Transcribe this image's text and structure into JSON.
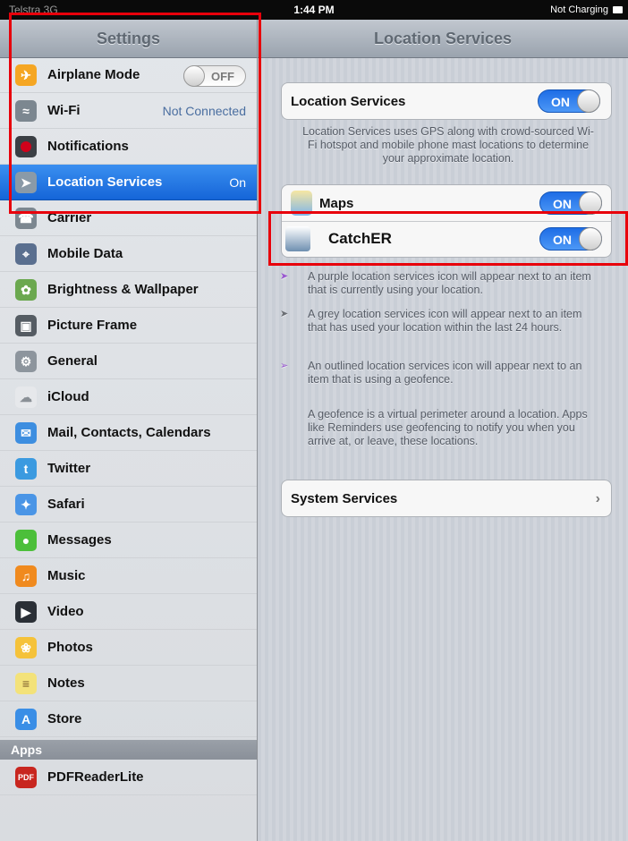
{
  "status_bar": {
    "carrier": "Telstra 3G",
    "time": "1:44 PM",
    "battery": "Not Charging"
  },
  "sidebar": {
    "title": "Settings",
    "items": [
      {
        "label": "Airplane Mode",
        "value": "",
        "toggle": "OFF",
        "icon": "airplane-icon",
        "color": "#f5a623"
      },
      {
        "label": "Wi-Fi",
        "value": "Not Connected",
        "icon": "wifi-icon",
        "color": "#7c8790"
      },
      {
        "label": "Notifications",
        "value": "",
        "icon": "notifications-icon",
        "color": "#d0021b"
      },
      {
        "label": "Location Services",
        "value": "On",
        "icon": "location-arrow-icon",
        "color": "#8a9aa8"
      },
      {
        "label": "Carrier",
        "value": "",
        "icon": "carrier-icon",
        "color": "#7c8790"
      },
      {
        "label": "Mobile Data",
        "value": "",
        "icon": "mobile-data-icon",
        "color": "#5a6f8f"
      },
      {
        "label": "Brightness & Wallpaper",
        "value": "",
        "icon": "brightness-icon",
        "color": "#6ba84f"
      },
      {
        "label": "Picture Frame",
        "value": "",
        "icon": "picture-frame-icon",
        "color": "#555c63"
      },
      {
        "label": "General",
        "value": "",
        "icon": "gear-icon",
        "color": "#8d959d"
      },
      {
        "label": "iCloud",
        "value": "",
        "icon": "icloud-icon",
        "color": "#c9ced4"
      },
      {
        "label": "Mail, Contacts, Calendars",
        "value": "",
        "icon": "mail-icon",
        "color": "#3d8ee0"
      },
      {
        "label": "Twitter",
        "value": "",
        "icon": "twitter-icon",
        "color": "#3b9ae0"
      },
      {
        "label": "Safari",
        "value": "",
        "icon": "safari-icon",
        "color": "#4a95e6"
      },
      {
        "label": "Messages",
        "value": "",
        "icon": "messages-icon",
        "color": "#4cbf3a"
      },
      {
        "label": "Music",
        "value": "",
        "icon": "music-icon",
        "color": "#f08a1e"
      },
      {
        "label": "Video",
        "value": "",
        "icon": "video-icon",
        "color": "#2a2f36"
      },
      {
        "label": "Photos",
        "value": "",
        "icon": "photos-icon",
        "color": "#f5c23a"
      },
      {
        "label": "Notes",
        "value": "",
        "icon": "notes-icon",
        "color": "#f3e27a"
      },
      {
        "label": "Store",
        "value": "",
        "icon": "store-icon",
        "color": "#3a8ee6"
      }
    ],
    "apps_header": "Apps",
    "apps": [
      {
        "label": "PDFReaderLite",
        "icon": "pdf-icon",
        "color": "#c8261f"
      }
    ]
  },
  "detail": {
    "title": "Location Services",
    "main_toggle": {
      "label": "Location Services",
      "state": "ON"
    },
    "main_description": "Location Services uses GPS along with crowd-sourced Wi-Fi hotspot and mobile phone mast locations to determine your approximate location.",
    "apps": [
      {
        "label": "Maps",
        "state": "ON",
        "icon": "maps-icon"
      },
      {
        "label": "CatchER",
        "state": "ON",
        "icon": "catcher-app-icon"
      }
    ],
    "notes": [
      {
        "text": "A purple location services icon will appear next to an item that is currently using your location.",
        "arrow_color": "#9b59d0"
      },
      {
        "text": "A grey location services icon will appear next to an item that has used your location within the last 24 hours.",
        "arrow_color": "#6b6f75"
      },
      {
        "text": "An outlined location services icon will appear next to an item that is using a geofence.",
        "arrow_color": "#9b59d0"
      }
    ],
    "geofence_text": "A geofence is a virtual perimeter around a location. Apps like Reminders use geofencing to notify you when you arrive at, or leave, these locations.",
    "system_services_label": "System Services"
  },
  "highlight_color": "#e8000b"
}
